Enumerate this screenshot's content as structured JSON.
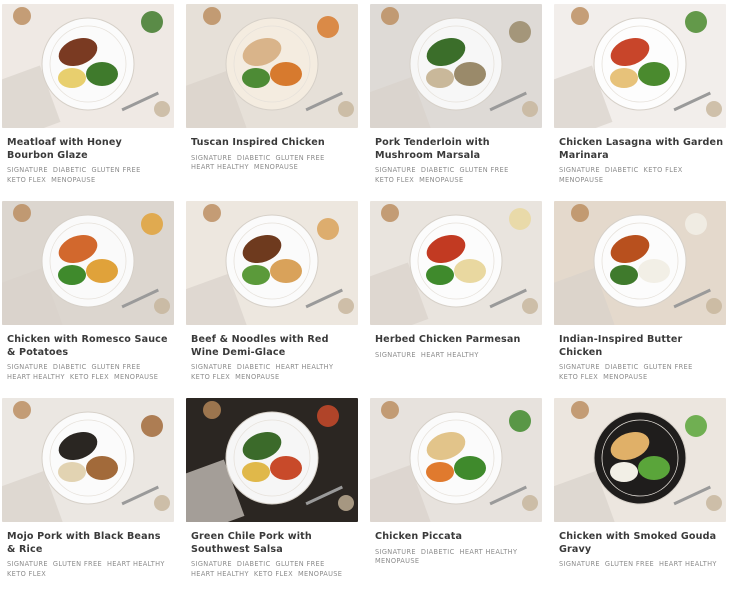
{
  "meals": [
    {
      "name": "Meatloaf with Honey Bourbon Glaze",
      "tags": [
        "Signature",
        "Diabetic",
        "Gluten Free",
        "Keto Flex",
        "Menopause"
      ],
      "bg": "#efe9e4",
      "plate": "#fbfbfb",
      "foods": [
        "#7a3a22",
        "#3f7a2c",
        "#e8cf6e"
      ]
    },
    {
      "name": "Tuscan Inspired Chicken",
      "tags": [
        "Signature",
        "Diabetic",
        "Gluten Free",
        "Heart Healthy",
        "Menopause"
      ],
      "bg": "#e6e0d8",
      "plate": "#f4ece0",
      "foods": [
        "#d9b48a",
        "#d77a2e",
        "#4d8b35"
      ]
    },
    {
      "name": "Pork Tenderloin with Mushroom Marsala",
      "tags": [
        "Signature",
        "Diabetic",
        "Gluten Free",
        "Keto Flex",
        "Menopause"
      ],
      "bg": "#dedad6",
      "plate": "#f7f7f7",
      "foods": [
        "#3b6e2a",
        "#9a8a6a",
        "#c9b89a"
      ]
    },
    {
      "name": "Chicken Lasagna with Garden Marinara",
      "tags": [
        "Signature",
        "Diabetic",
        "Keto Flex",
        "Menopause"
      ],
      "bg": "#f2eeeb",
      "plate": "#fdfdfd",
      "foods": [
        "#c8452a",
        "#4a8a2e",
        "#e7c27a"
      ]
    },
    {
      "name": "Chicken with Romesco Sauce & Potatoes",
      "tags": [
        "Signature",
        "Diabetic",
        "Gluten Free",
        "Heart Healthy",
        "Keto Flex",
        "Menopause"
      ],
      "bg": "#dcd6cf",
      "plate": "#fafafa",
      "foods": [
        "#d2682d",
        "#e0a23a",
        "#3f8a2c"
      ]
    },
    {
      "name": "Beef & Noodles with Red Wine Demi-Glace",
      "tags": [
        "Signature",
        "Diabetic",
        "Heart Healthy",
        "Keto Flex",
        "Menopause"
      ],
      "bg": "#ede7df",
      "plate": "#fbfbfb",
      "foods": [
        "#6e3a1e",
        "#d9a25a",
        "#5b9a3a"
      ]
    },
    {
      "name": "Herbed Chicken Parmesan",
      "tags": [
        "Signature",
        "Heart Healthy"
      ],
      "bg": "#e9e4de",
      "plate": "#fcfcfc",
      "foods": [
        "#c23a22",
        "#e9d8a0",
        "#3f8a2c"
      ]
    },
    {
      "name": "Indian-Inspired Butter Chicken",
      "tags": [
        "Signature",
        "Diabetic",
        "Gluten Free",
        "Keto Flex",
        "Menopause"
      ],
      "bg": "#e4d9cc",
      "plate": "#fcfcfc",
      "foods": [
        "#b8501e",
        "#f2efe6",
        "#3f7a2c"
      ]
    },
    {
      "name": "Mojo Pork with Black Beans & Rice",
      "tags": [
        "Signature",
        "Gluten Free",
        "Heart Healthy",
        "Keto Flex"
      ],
      "bg": "#ebe7e2",
      "plate": "#fbfbfb",
      "foods": [
        "#2a2622",
        "#a26a3a",
        "#e2d3b2"
      ]
    },
    {
      "name": "Green Chile Pork with Southwest Salsa",
      "tags": [
        "Signature",
        "Diabetic",
        "Gluten Free",
        "Heart Healthy",
        "Keto Flex",
        "Menopause"
      ],
      "bg": "#2b2622",
      "plate": "#f6f6f6",
      "foods": [
        "#3b6a2a",
        "#c84a2a",
        "#e0b84a"
      ]
    },
    {
      "name": "Chicken Piccata",
      "tags": [
        "Signature",
        "Diabetic",
        "Heart Healthy",
        "Menopause"
      ],
      "bg": "#e7e2dd",
      "plate": "#fbfbfb",
      "foods": [
        "#e2c48a",
        "#3f8a2c",
        "#e07a2e"
      ]
    },
    {
      "name": "Chicken with Smoked Gouda Gravy",
      "tags": [
        "Signature",
        "Gluten Free",
        "Heart Healthy"
      ],
      "bg": "#ece6df",
      "plate": "#1f1d1c",
      "foods": [
        "#e0b068",
        "#5aa53a",
        "#f2efe6"
      ]
    }
  ]
}
